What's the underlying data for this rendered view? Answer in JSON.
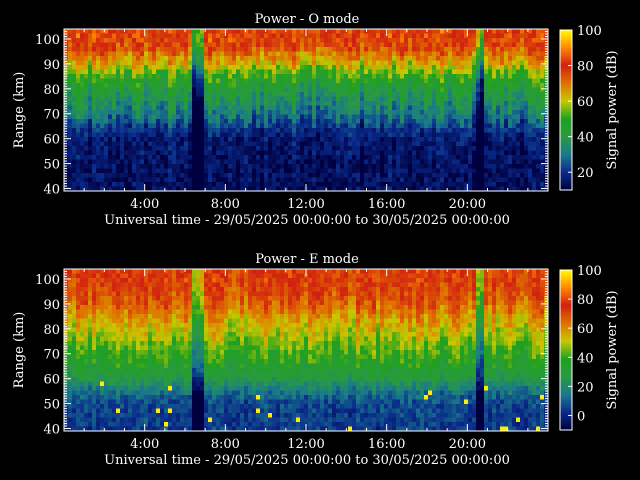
{
  "panels": [
    {
      "title": "Power - O mode",
      "ylabel": "Range (km)",
      "xlabel": "Universal time - 29/05/2025 00:00:00 to 30/05/2025 00:00:00",
      "cbar_label": "Signal power (dB)"
    },
    {
      "title": "Power - E mode",
      "ylabel": "Range (km)",
      "xlabel": "Universal time - 29/05/2025 00:00:00 to 30/05/2025 00:00:00",
      "cbar_label": "Signal power (dB)"
    }
  ],
  "chart_data": [
    {
      "type": "heatmap",
      "title": "Power - O mode",
      "xlabel": "Universal time - 29/05/2025 00:00:00 to 30/05/2025 00:00:00",
      "ylabel": "Range (km)",
      "colorbar_label": "Signal power (dB)",
      "x_range_hours": [
        0,
        24
      ],
      "x_ticks": [
        "4:00",
        "8:00",
        "12:00",
        "16:00",
        "20:00"
      ],
      "y_range_km": [
        39,
        104
      ],
      "y_ticks": [
        40,
        50,
        60,
        70,
        80,
        90,
        100
      ],
      "colorbar_range_db": [
        10,
        100
      ],
      "colorbar_ticks": [
        20,
        40,
        60,
        80,
        100
      ],
      "colormap": [
        "#000040",
        "#0a2a8a",
        "#1a7a8a",
        "#2a9a40",
        "#20a020",
        "#c8c800",
        "#e07000",
        "#d02010",
        "#ff8800",
        "#ffff00"
      ],
      "profile": [
        {
          "range_km": 40,
          "power_db": 14
        },
        {
          "range_km": 50,
          "power_db": 14
        },
        {
          "range_km": 60,
          "power_db": 16
        },
        {
          "range_km": 65,
          "power_db": 22
        },
        {
          "range_km": 70,
          "power_db": 30
        },
        {
          "range_km": 75,
          "power_db": 36
        },
        {
          "range_km": 80,
          "power_db": 42
        },
        {
          "range_km": 85,
          "power_db": 50
        },
        {
          "range_km": 90,
          "power_db": 62
        },
        {
          "range_km": 95,
          "power_db": 72
        },
        {
          "range_km": 100,
          "power_db": 80
        }
      ]
    },
    {
      "type": "heatmap",
      "title": "Power - E mode",
      "xlabel": "Universal time - 29/05/2025 00:00:00 to 30/05/2025 00:00:00",
      "ylabel": "Range (km)",
      "colorbar_label": "Signal power (dB)",
      "x_range_hours": [
        0,
        24
      ],
      "x_ticks": [
        "4:00",
        "8:00",
        "12:00",
        "16:00",
        "20:00"
      ],
      "y_range_km": [
        39,
        104
      ],
      "y_ticks": [
        40,
        50,
        60,
        70,
        80,
        90,
        100
      ],
      "colorbar_range_db": [
        -10,
        100
      ],
      "colorbar_ticks": [
        0,
        20,
        40,
        60,
        80,
        100
      ],
      "colormap": [
        "#000040",
        "#0a2a8a",
        "#1a7a8a",
        "#2a9a40",
        "#20a020",
        "#c8c800",
        "#e07000",
        "#d02010",
        "#ff8800",
        "#ffff00"
      ],
      "profile": [
        {
          "range_km": 40,
          "power_db": 4
        },
        {
          "range_km": 50,
          "power_db": 6
        },
        {
          "range_km": 55,
          "power_db": 14
        },
        {
          "range_km": 60,
          "power_db": 26
        },
        {
          "range_km": 65,
          "power_db": 34
        },
        {
          "range_km": 70,
          "power_db": 40
        },
        {
          "range_km": 75,
          "power_db": 46
        },
        {
          "range_km": 80,
          "power_db": 52
        },
        {
          "range_km": 85,
          "power_db": 58
        },
        {
          "range_km": 90,
          "power_db": 66
        },
        {
          "range_km": 100,
          "power_db": 74
        }
      ]
    }
  ]
}
